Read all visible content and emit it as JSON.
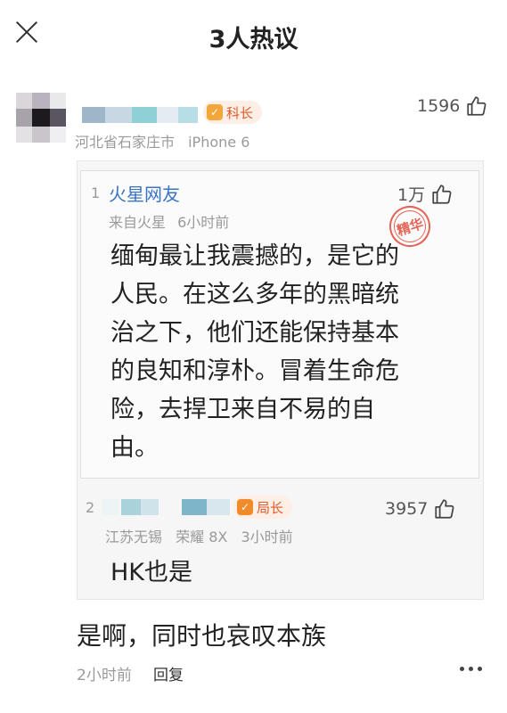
{
  "header": {
    "title": "3人热议",
    "close_icon": "close-icon"
  },
  "comment": {
    "badge_label": "科长",
    "badge_icon": "shield-icon",
    "location": "河北省石家庄市",
    "device": "iPhone 6",
    "likes": "1596",
    "text": "是啊，同时也哀叹本族",
    "time": "2小时前",
    "reply_label": "回复"
  },
  "thread": [
    {
      "floor": "1",
      "name": "火星网友",
      "source": "来自火星",
      "time": "6小时前",
      "likes": "1万",
      "stamp": "精华",
      "lines": [
        "缅甸最让我震撼的，是它的",
        "人民。在这么多年的黑暗统",
        "治之下，他们还能保持基本",
        "的良知和淳朴。冒着生命危",
        "险，去捍卫来自不易的自",
        "由。"
      ]
    },
    {
      "floor": "2",
      "badge_label": "局长",
      "badge_icon": "shield-icon",
      "location": "江苏无锡",
      "device": "荣耀 8X",
      "time": "3小时前",
      "likes": "3957",
      "text": "HK也是"
    }
  ],
  "colors": {
    "link_blue": "#3a74c4",
    "badge_orange": "#e05c2a",
    "stamp_red": "#e04a3a",
    "meta_gray": "#9a9a9a"
  }
}
